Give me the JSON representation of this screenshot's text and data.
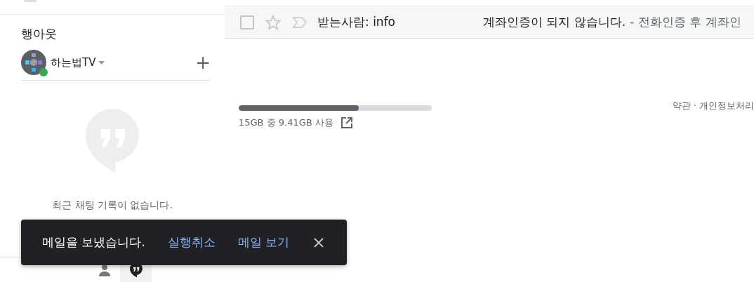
{
  "hangouts": {
    "title": "행아웃",
    "user": {
      "name": "하는법TV",
      "online": true
    },
    "add_label": "+",
    "empty_message": "최근 채팅 기록이 없습니다.",
    "bottom_tabs": [
      {
        "kind": "contacts",
        "selected": false
      },
      {
        "kind": "chat",
        "selected": true
      }
    ]
  },
  "mail_row": {
    "checked": false,
    "starred": false,
    "recipient": "받는사람: info",
    "subject": "계좌인증이 되지 않습니다.",
    "snippet": "- 전화인증 후 계좌인"
  },
  "storage": {
    "level": 0.62,
    "text": "15GB 중 9.41GB 사용"
  },
  "footer": {
    "links": "약관 · 개인정보처리"
  },
  "snackbar": {
    "message": "메일을 보냈습니다.",
    "actions": [
      "실행취소",
      "메일 보기"
    ]
  }
}
